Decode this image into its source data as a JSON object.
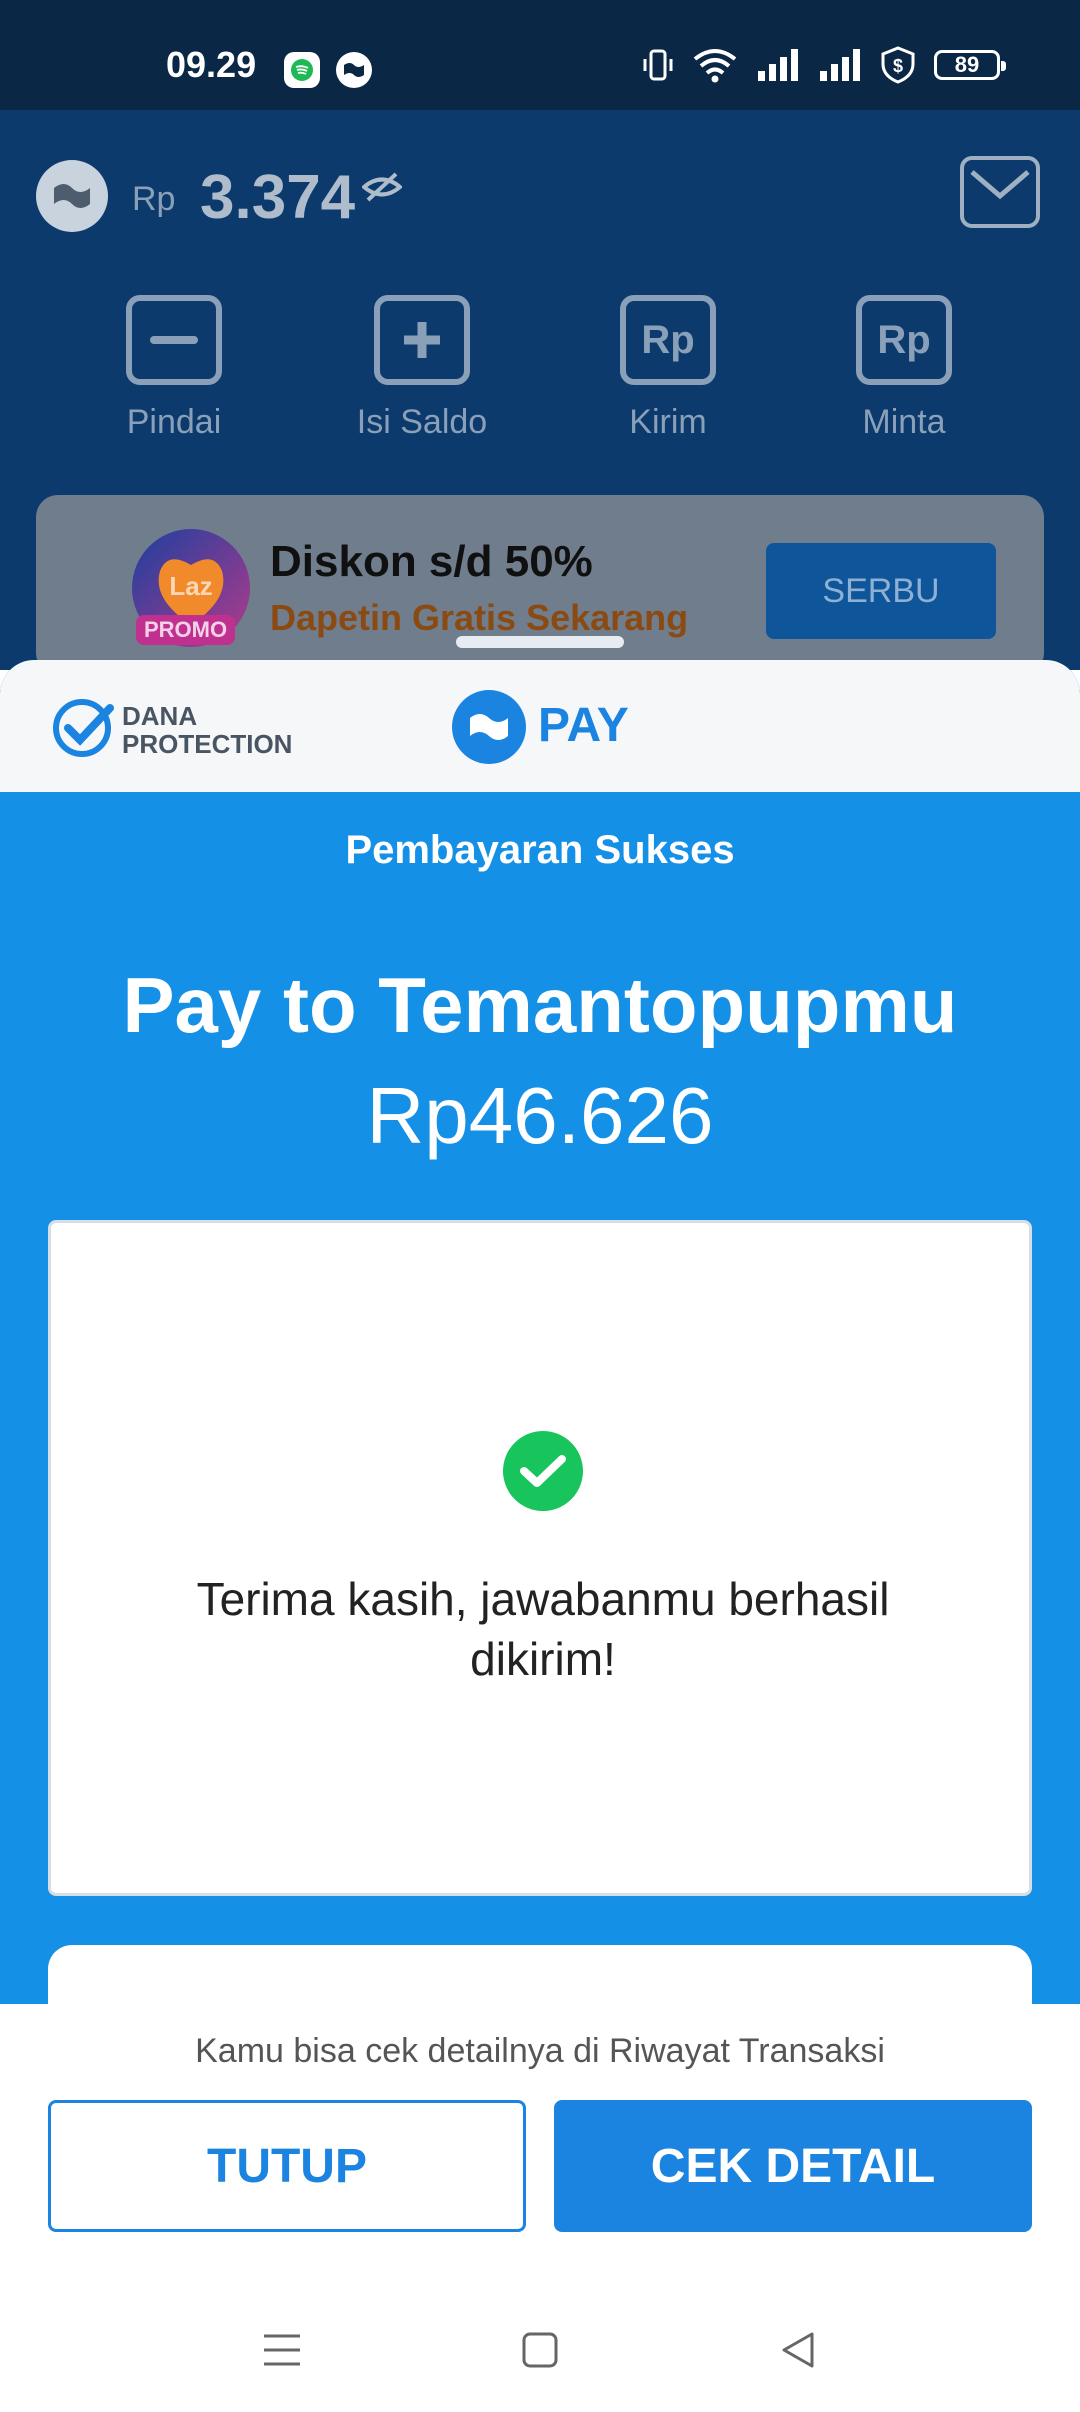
{
  "status_bar": {
    "time": "09.29",
    "battery": "89"
  },
  "wallet": {
    "currency": "Rp",
    "balance": "3.374",
    "actions": [
      {
        "label": "Pindai",
        "icon": "scan-icon"
      },
      {
        "label": "Isi Saldo",
        "icon": "topup-icon"
      },
      {
        "label": "Kirim",
        "icon": "send-icon"
      },
      {
        "label": "Minta",
        "icon": "request-icon"
      }
    ],
    "promo": {
      "logo_text": "Laz",
      "badge": "PROMO",
      "title": "Diskon s/d 50%",
      "subtitle": "Dapetin Gratis Sekarang",
      "button": "SERBU"
    }
  },
  "sheet": {
    "protection_brand": [
      "DANA",
      "PROTECTION"
    ],
    "pay_brand": "PAY",
    "status_title": "Pembayaran Sukses",
    "merchant": "Pay to Temantopupmu",
    "amount": "Rp46.626",
    "message": "Terima kasih, jawabanmu berhasil dikirim!"
  },
  "footer": {
    "hint": "Kamu bisa cek detailnya di Riwayat Transaksi",
    "close_label": "TUTUP",
    "detail_label": "CEK DETAIL"
  },
  "colors": {
    "primary": "#1b84e0",
    "sheet_bg": "#1490e6",
    "success": "#18c45c",
    "header_dark": "#0b2746"
  }
}
